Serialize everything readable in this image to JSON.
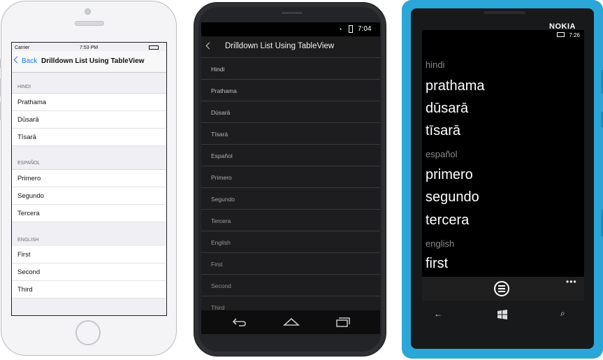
{
  "ios": {
    "status": {
      "carrier": "Carrier",
      "time": "7:53 PM"
    },
    "nav": {
      "back_label": "Back",
      "title": "Drilldown List Using TableView"
    },
    "sections": [
      {
        "header": "HINDI",
        "rows": [
          "Prathama",
          "Dūsarā",
          "Tīsarā"
        ]
      },
      {
        "header": "ESPAÑOL",
        "rows": [
          "Primero",
          "Segundo",
          "Tercera"
        ]
      },
      {
        "header": "ENGLISH",
        "rows": [
          "First",
          "Second",
          "Third"
        ]
      }
    ]
  },
  "android": {
    "status": {
      "time": "7:04"
    },
    "title": "Drilldown List Using TableView",
    "rows": [
      "Hindi",
      "Prathama",
      "Dūsarā",
      "Tīsarā",
      "Español",
      "Primero",
      "Segundo",
      "Tercera",
      "English",
      "First",
      "Second",
      "Third"
    ]
  },
  "windows_phone": {
    "brand": "NOKIA",
    "status": {
      "time": "7:26"
    },
    "groups": [
      {
        "header": "hindi",
        "items": [
          "prathama",
          "dūsarā",
          "tīsarā"
        ]
      },
      {
        "header": "español",
        "items": [
          "primero",
          "segundo",
          "tercera"
        ]
      },
      {
        "header": "english",
        "items": [
          "first"
        ]
      }
    ],
    "appbar": {
      "more": "•••"
    },
    "hardware_keys": {
      "back": "←",
      "search": "⌕"
    }
  },
  "colors": {
    "ios_tint": "#1a7cf5",
    "lumia_body": "#2aa6d9",
    "android_bg": "#1d1d1f"
  }
}
